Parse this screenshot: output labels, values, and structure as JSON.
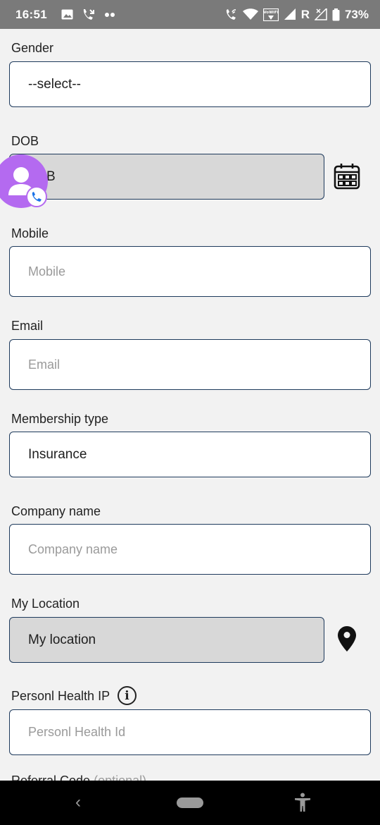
{
  "status_bar": {
    "time": "16:51",
    "left_icons": [
      "image-icon",
      "missed-call-icon",
      "more-dots-icon"
    ],
    "right_icons": [
      "wifi-calling-icon",
      "wifi-icon",
      "vowifi-icon",
      "signal-icon",
      "roaming-icon",
      "battery-icon"
    ],
    "vowifi_label": "VoWiFi",
    "roaming_label": "R",
    "battery_percent": "73%"
  },
  "form": {
    "gender": {
      "label": "Gender",
      "value": "--select--"
    },
    "dob": {
      "label": "DOB",
      "value": "DOB",
      "visible_value_fragment": "B"
    },
    "mobile": {
      "label": "Mobile",
      "placeholder": "Mobile"
    },
    "email": {
      "label": "Email",
      "placeholder": "Email"
    },
    "membership_type": {
      "label": "Membership type",
      "value": "Insurance"
    },
    "company_name": {
      "label": "Company name",
      "placeholder": "Company name"
    },
    "my_location": {
      "label": "My Location",
      "value": "My location"
    },
    "health_id": {
      "label": "Personl Health IP",
      "placeholder": "Personl Health Id",
      "info_symbol": "i"
    },
    "referral": {
      "label": "Referral Code",
      "optional": "(optional)"
    }
  },
  "icons": {
    "calendar": "calendar-icon",
    "location": "location-pin-icon",
    "chat_head": "contact-bubble-icon"
  },
  "nav_bar": {
    "back_symbol": "‹"
  },
  "colors": {
    "accent_border": "#1e3a5c",
    "chat_head": "#b46af0",
    "status_bar": "#7a7a7a",
    "disabled_field": "#d8d8d8"
  }
}
